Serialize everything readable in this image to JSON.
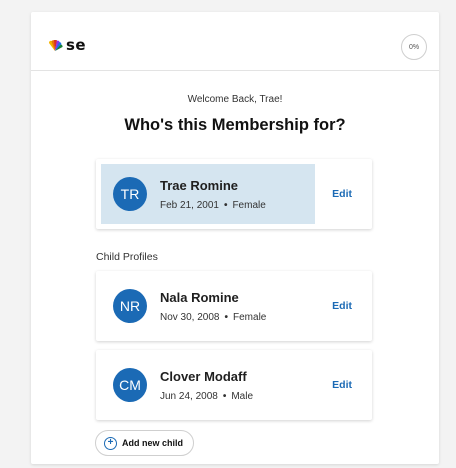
{
  "header": {
    "logo_text": "se",
    "progress_label": "0%"
  },
  "welcome": "Welcome Back, Trae!",
  "title": "Who's this Membership for?",
  "primary_profile": {
    "initials": "TR",
    "name": "Trae Romine",
    "dob": "Feb 21, 2001",
    "separator": "•",
    "gender": "Female",
    "edit_label": "Edit"
  },
  "child_section_label": "Child Profiles",
  "children": [
    {
      "initials": "NR",
      "name": "Nala Romine",
      "dob": "Nov 30, 2008",
      "separator": "•",
      "gender": "Female",
      "edit_label": "Edit"
    },
    {
      "initials": "CM",
      "name": "Clover Modaff",
      "dob": "Jun 24, 2008",
      "separator": "•",
      "gender": "Male",
      "edit_label": "Edit"
    }
  ],
  "add_child_label": "Add new child",
  "colors": {
    "accent": "#1b6ab5",
    "selected_bg": "#d5e5f0"
  }
}
